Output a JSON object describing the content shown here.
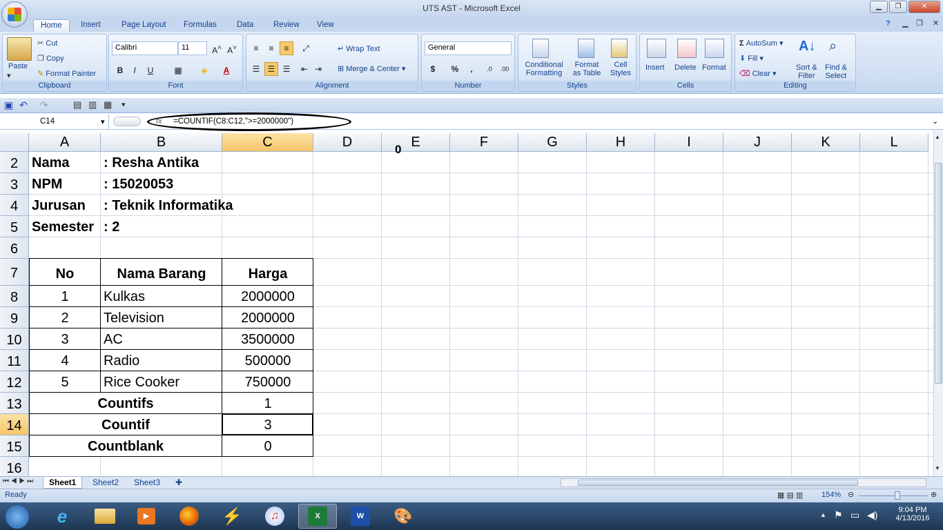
{
  "window": {
    "title": "UTS AST - Microsoft Excel",
    "min": "▁",
    "max": "❐",
    "close": "✕"
  },
  "tabs": [
    "Home",
    "Insert",
    "Page Layout",
    "Formulas",
    "Data",
    "Review",
    "View"
  ],
  "ribbon": {
    "clipboard": {
      "label": "Clipboard",
      "paste": "Paste",
      "cut": "Cut",
      "copy": "Copy",
      "format_painter": "Format Painter"
    },
    "font": {
      "label": "Font",
      "name": "Calibri",
      "size": "11",
      "bold": "B",
      "italic": "I",
      "underline": "U"
    },
    "alignment": {
      "label": "Alignment",
      "wrap": "Wrap Text",
      "merge": "Merge & Center"
    },
    "number": {
      "label": "Number",
      "format": "General",
      "currency": "$",
      "percent": "%",
      "comma": ","
    },
    "styles": {
      "label": "Styles",
      "cond1": "Conditional",
      "cond2": "Formatting",
      "fmt1": "Format",
      "fmt2": "as Table",
      "cell1": "Cell",
      "cell2": "Styles"
    },
    "cells": {
      "label": "Cells",
      "insert": "Insert",
      "delete": "Delete",
      "format": "Format"
    },
    "editing": {
      "label": "Editing",
      "autosum": "AutoSum",
      "fill": "Fill",
      "clear": "Clear",
      "sort1": "Sort &",
      "sort2": "Filter",
      "find1": "Find &",
      "find2": "Select"
    }
  },
  "formula_bar": {
    "name_box": "C14",
    "fx": "fx",
    "formula": "=COUNTIF(C8:C12,\">=2000000\")"
  },
  "columns": [
    "A",
    "B",
    "C",
    "D",
    "E",
    "F",
    "G",
    "H",
    "I",
    "J",
    "K",
    "L"
  ],
  "rows": [
    "2",
    "3",
    "4",
    "5",
    "6",
    "7",
    "8",
    "9",
    "10",
    "11",
    "12",
    "13",
    "14",
    "15",
    "16"
  ],
  "sheet": {
    "info": [
      {
        "label": "Nama",
        "value": ": Resha Antika"
      },
      {
        "label": "NPM",
        "value": ": 15020053"
      },
      {
        "label": "Jurusan",
        "value": ": Teknik Informatika"
      },
      {
        "label": "Semester",
        "value": ": 2"
      }
    ],
    "table_headers": [
      "No",
      "Nama Barang",
      "Harga"
    ],
    "items": [
      {
        "no": "1",
        "name": "Kulkas",
        "price": "2000000"
      },
      {
        "no": "2",
        "name": "Television",
        "price": "2000000"
      },
      {
        "no": "3",
        "name": "AC",
        "price": "3500000"
      },
      {
        "no": "4",
        "name": "Radio",
        "price": "500000"
      },
      {
        "no": "5",
        "name": "Rice Cooker",
        "price": "750000"
      }
    ],
    "summary": [
      {
        "label": "Countifs",
        "value": "1"
      },
      {
        "label": "Countif",
        "value": "3"
      },
      {
        "label": "Countblank",
        "value": "0"
      }
    ],
    "annotation": "0"
  },
  "sheet_tabs": [
    "Sheet1",
    "Sheet2",
    "Sheet3"
  ],
  "status": {
    "text": "Ready",
    "zoom": "154%"
  },
  "taskbar": {
    "time": "9:04 PM",
    "date": "4/13/2016"
  }
}
